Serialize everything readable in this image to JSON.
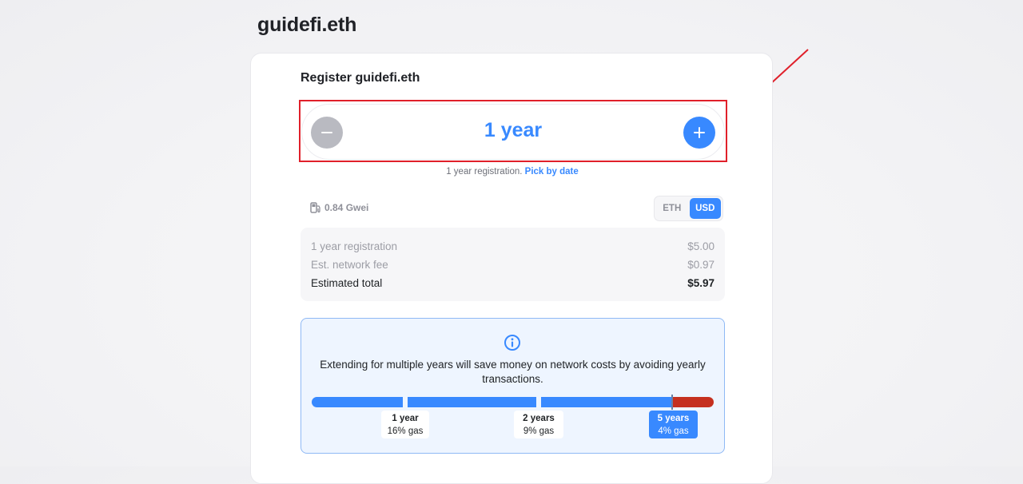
{
  "page": {
    "title": "guidefi.eth"
  },
  "register": {
    "heading": "Register guidefi.eth",
    "duration_value": "1 year",
    "decrease_label": "−",
    "increase_label": "+",
    "hint_prefix": "1 year registration.",
    "pick_by_date_link": "Pick by date"
  },
  "gas": {
    "icon": "gas-pump-icon",
    "price": "0.84 Gwei"
  },
  "currency_toggle": {
    "options": [
      "ETH",
      "USD"
    ],
    "selected": "USD"
  },
  "fees": {
    "rows": [
      {
        "label": "1 year registration",
        "value": "$5.00"
      },
      {
        "label": "Est. network fee",
        "value": "$0.97"
      },
      {
        "label": "Estimated total",
        "value": "$5.97"
      }
    ]
  },
  "info": {
    "icon": "info-icon",
    "message": "Extending for multiple years will save money on network costs by avoiding yearly transactions.",
    "gas_savings": [
      {
        "years": "1 year",
        "gas": "16% gas"
      },
      {
        "years": "2 years",
        "gas": "9% gas"
      },
      {
        "years": "5 years",
        "gas": "4% gas",
        "selected_highlight": true
      }
    ]
  },
  "colors": {
    "accent": "#3889ff",
    "highlight_annotation": "#e0202a",
    "bar_red": "#c5301f"
  }
}
